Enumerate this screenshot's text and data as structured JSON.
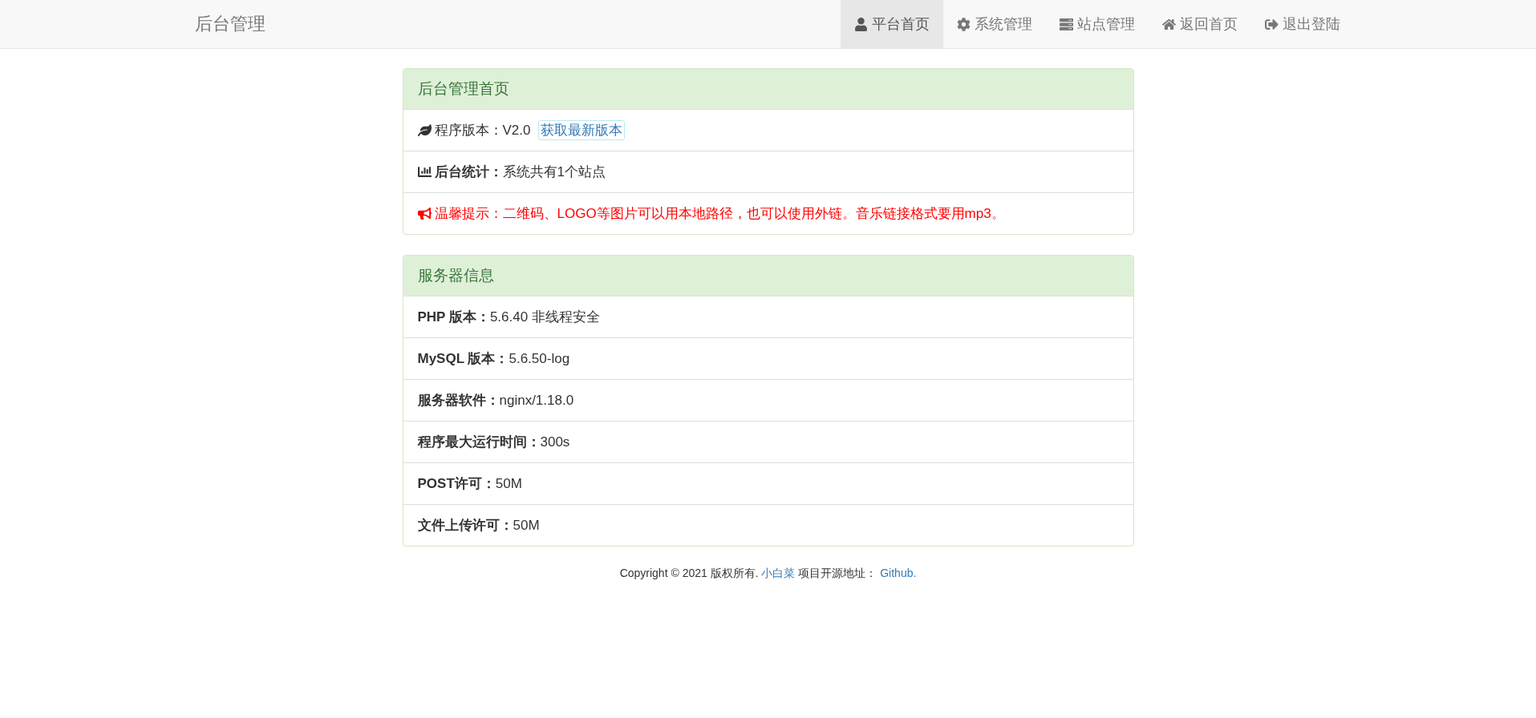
{
  "navbar": {
    "brand": "后台管理",
    "items": [
      {
        "label": "平台首页",
        "selected": true
      },
      {
        "label": "系统管理",
        "selected": false
      },
      {
        "label": "站点管理",
        "selected": false
      },
      {
        "label": "返回首页",
        "selected": false
      },
      {
        "label": "退出登陆",
        "selected": false
      }
    ]
  },
  "panels": [
    {
      "title": "后台管理首页",
      "rows": [
        {
          "kind": "version",
          "text": "程序版本：V2.0",
          "link": "获取最新版本"
        },
        {
          "kind": "stats",
          "text": "**后台统计：**系统共有1个站点"
        },
        {
          "kind": "notice",
          "text": "温馨提示：二维码、LOGO等图片可以用本地路径，也可以使用外链。音乐链接格式要用mp3。"
        }
      ]
    },
    {
      "title": "服务器信息",
      "rows": [
        {
          "kind": "plain",
          "text": "**PHP 版本：**5.6.40 非线程安全"
        },
        {
          "kind": "plain",
          "text": "**MySQL 版本：**5.6.50-log"
        },
        {
          "kind": "plain",
          "text": "**服务器软件：**nginx/1.18.0"
        },
        {
          "kind": "plain",
          "text": "**程序最大运行时间：**300s"
        },
        {
          "kind": "plain",
          "text": "**POST许可：**50M"
        },
        {
          "kind": "plain",
          "text": "**文件上传许可：**50M"
        }
      ]
    }
  ],
  "footer": {
    "parts": [
      {
        "kind": "text",
        "text": "Copyright © 2021 版权所有. "
      },
      {
        "kind": "link",
        "text": "小白菜"
      },
      {
        "kind": "text",
        "text": " 项目开源地址： "
      },
      {
        "kind": "link",
        "text": "Github."
      }
    ]
  }
}
